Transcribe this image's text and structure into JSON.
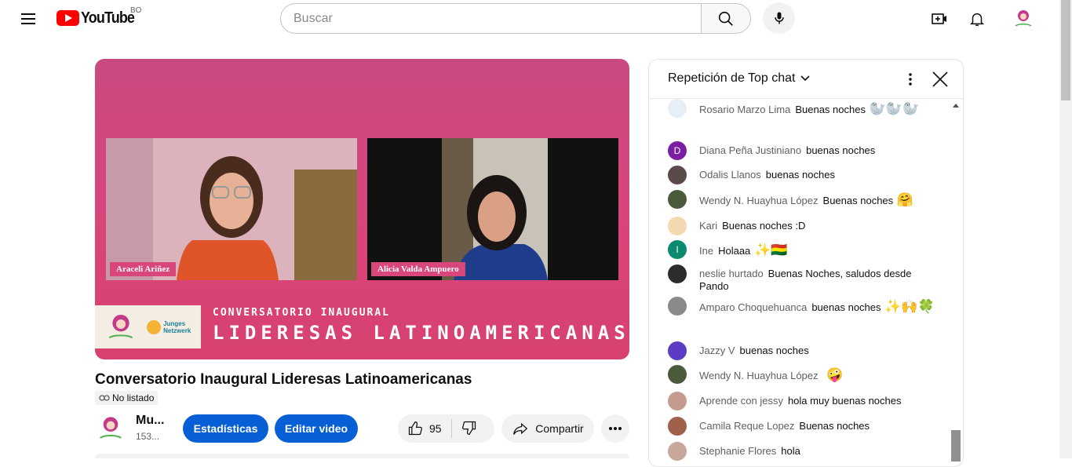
{
  "header": {
    "logo_text": "YouTube",
    "country_code": "BO",
    "search_placeholder": "Buscar"
  },
  "video": {
    "title": "Conversatorio Inaugural Lideresas Latinoamericanas",
    "visibility": "No listado",
    "frame_left_name": "Araceli Ariñez",
    "frame_right_name": "Alicia Valda Ampuero",
    "banner_subtitle": "CONVERSATORIO INAUGURAL",
    "banner_title": "LIDERESAS LATINOAMERICANAS",
    "partner_logo_text_1": "Junges",
    "partner_logo_text_2": "Netzwerk"
  },
  "channel": {
    "name": "Mu...",
    "subs": "153...",
    "stats_label": "Estadísticas",
    "edit_label": "Editar video"
  },
  "actions": {
    "likes": "95",
    "share_label": "Compartir"
  },
  "chat": {
    "title": "Repetición de Top chat",
    "messages": [
      {
        "author": "Rosario Marzo Lima",
        "text": "Buenas noches",
        "emoji": "🦭🦭🦭",
        "avatar_color": "#e8eef5",
        "avatar_letter": ""
      },
      {
        "author": "Diana Peña Justiniano",
        "text": "buenas noches",
        "emoji": "",
        "avatar_color": "#7b1fa2",
        "avatar_letter": "D"
      },
      {
        "author": "Odalis Llanos",
        "text": "buenas noches",
        "emoji": "",
        "avatar_color": "#5a4a4a",
        "avatar_letter": ""
      },
      {
        "author": "Wendy N. Huayhua López",
        "text": "Buenas noches",
        "emoji": "🤗",
        "avatar_color": "#4b5a3a",
        "avatar_letter": ""
      },
      {
        "author": "Kari",
        "text": "Buenas noches :D",
        "emoji": "",
        "avatar_color": "#f3d9b1",
        "avatar_letter": ""
      },
      {
        "author": "Ine",
        "text": "Holaaa",
        "emoji": "✨🇧🇴",
        "avatar_color": "#0b8a6f",
        "avatar_letter": "I"
      },
      {
        "author": "neslie hurtado",
        "text": "Buenas Noches, saludos desde Pando",
        "emoji": "",
        "avatar_color": "#2c2c2c",
        "avatar_letter": ""
      },
      {
        "author": "Amparo Choquehuanca",
        "text": "buenas noches",
        "emoji": "✨🙌🍀",
        "avatar_color": "#8a8a8a",
        "avatar_letter": ""
      },
      {
        "author": "Jazzy V",
        "text": "buenas noches",
        "emoji": "",
        "avatar_color": "#5b3cc4",
        "avatar_letter": ""
      },
      {
        "author": "Wendy N. Huayhua López",
        "text": "",
        "emoji": "🤪",
        "avatar_color": "#4b5a3a",
        "avatar_letter": ""
      },
      {
        "author": "Aprende con jessy",
        "text": "hola muy buenas noches",
        "emoji": "",
        "avatar_color": "#c59b8f",
        "avatar_letter": ""
      },
      {
        "author": "Camila Reque Lopez",
        "text": "Buenas noches",
        "emoji": "",
        "avatar_color": "#a0604a",
        "avatar_letter": ""
      },
      {
        "author": "Stephanie Flores",
        "text": "hola",
        "emoji": "",
        "avatar_color": "#c8a89a",
        "avatar_letter": ""
      }
    ]
  }
}
